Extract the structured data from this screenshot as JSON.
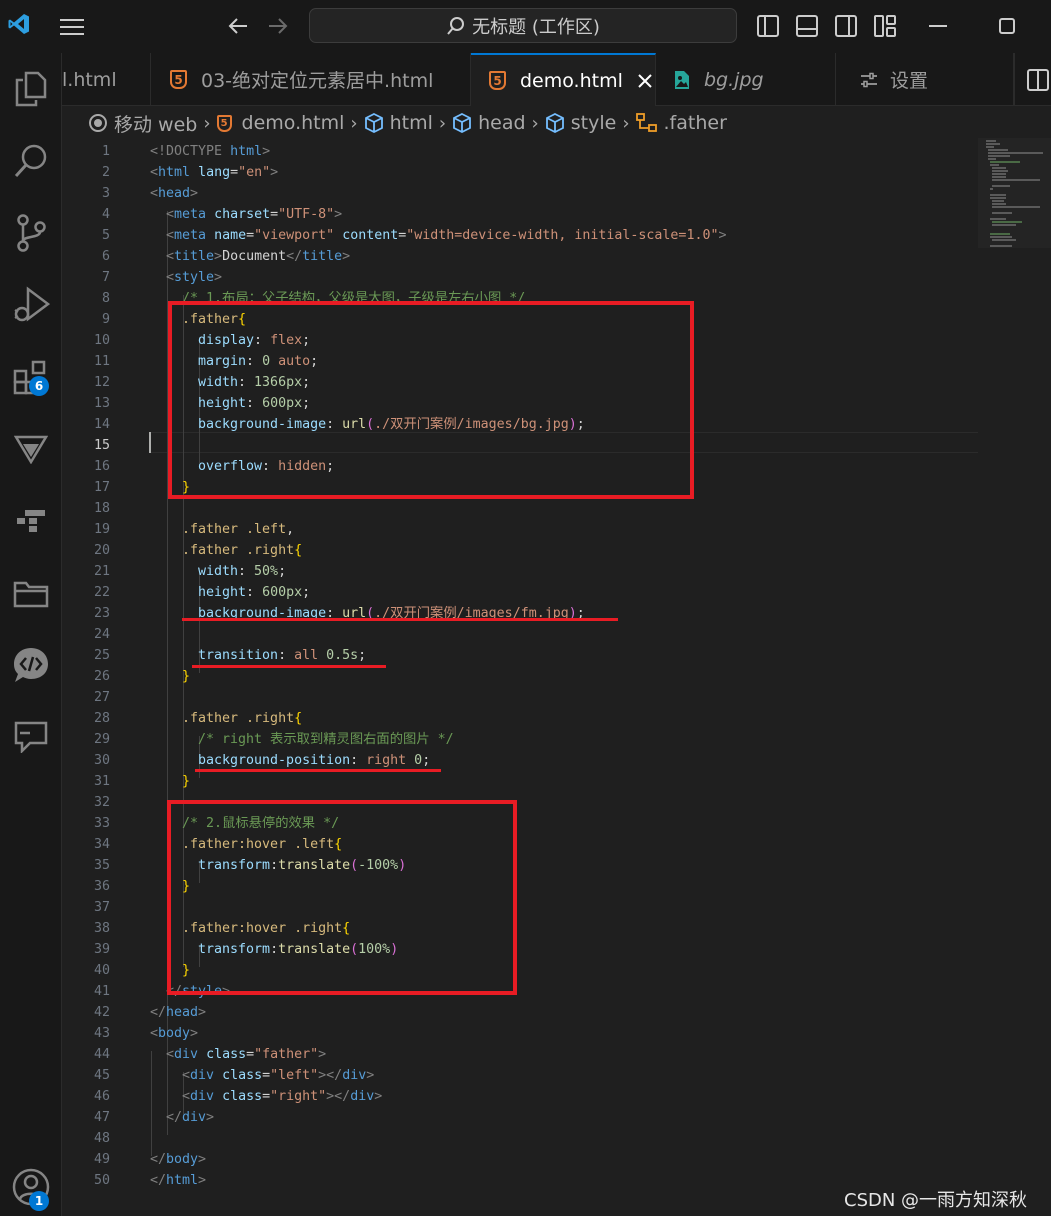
{
  "titlebar": {
    "search_text": "无标题 (工作区)"
  },
  "activity": {
    "extensions_badge": "6",
    "accounts_badge": "1"
  },
  "tabs": [
    {
      "label": "l.html"
    },
    {
      "label": "03-绝对定位元素居中.html"
    },
    {
      "label": "demo.html"
    },
    {
      "label": "bg.jpg"
    },
    {
      "label": "设置"
    }
  ],
  "breadcrumb": [
    "移动 web",
    "demo.html",
    "html",
    "head",
    "style",
    ".father"
  ],
  "line_numbers": [
    "1",
    "2",
    "3",
    "4",
    "5",
    "6",
    "7",
    "8",
    "9",
    "10",
    "11",
    "12",
    "13",
    "14",
    "15",
    "16",
    "17",
    "18",
    "19",
    "20",
    "21",
    "22",
    "23",
    "24",
    "25",
    "26",
    "27",
    "28",
    "29",
    "30",
    "31",
    "32",
    "33",
    "34",
    "35",
    "36",
    "37",
    "38",
    "39",
    "40",
    "41",
    "42",
    "43",
    "44",
    "45",
    "46",
    "47",
    "48",
    "49",
    "50"
  ],
  "code": {
    "l1": [
      "<!DOCTYPE ",
      "html",
      ">"
    ],
    "l2": [
      "<",
      "html",
      " ",
      "lang",
      "=",
      "\"en\"",
      ">"
    ],
    "l3": [
      "<",
      "head",
      ">"
    ],
    "l4": [
      "<",
      "meta",
      " ",
      "charset",
      "=",
      "\"UTF-8\"",
      ">"
    ],
    "l5": [
      "<",
      "meta",
      " ",
      "name",
      "=",
      "\"viewport\"",
      " ",
      "content",
      "=",
      "\"width=device-width, initial-scale=1.0\"",
      ">"
    ],
    "l6": [
      "<",
      "title",
      ">",
      "Document",
      "</",
      "title",
      ">"
    ],
    "l7": [
      "<",
      "style",
      ">"
    ],
    "l8": "/* 1.布局：父子结构，父级是大图，子级是左右小图 */",
    "l9": [
      ".father",
      "{"
    ],
    "l10": [
      "display",
      ": ",
      "flex",
      ";"
    ],
    "l11": [
      "margin",
      ": ",
      "0",
      " ",
      "auto",
      ";"
    ],
    "l12": [
      "width",
      ": ",
      "1366px",
      ";"
    ],
    "l13": [
      "height",
      ": ",
      "600px",
      ";"
    ],
    "l14": [
      "background-image",
      ": ",
      "url",
      "(",
      "./双开门案例/images/bg.jpg",
      ")",
      ";"
    ],
    "l16": [
      "overflow",
      ": ",
      "hidden",
      ";"
    ],
    "l17": "}",
    "l19": [
      ".father .left",
      ","
    ],
    "l20": [
      ".father .right",
      "{"
    ],
    "l21": [
      "width",
      ": ",
      "50%",
      ";"
    ],
    "l22": [
      "height",
      ": ",
      "600px",
      ";"
    ],
    "l23": [
      "background-image",
      ": ",
      "url",
      "(",
      "./双开门案例/images/fm.jpg",
      ")",
      ";"
    ],
    "l25": [
      "transition",
      ": ",
      "all",
      " ",
      "0.5s",
      ";"
    ],
    "l26": "}",
    "l28": [
      ".father .right",
      "{"
    ],
    "l29": "/* right 表示取到精灵图右面的图片 */",
    "l30": [
      "background-position",
      ": ",
      "right",
      " ",
      "0",
      ";"
    ],
    "l31": "}",
    "l33": "/* 2.鼠标悬停的效果 */",
    "l34": [
      ".father:hover .left",
      "{"
    ],
    "l35": [
      "transform",
      ":",
      "translate",
      "(",
      "-100%",
      ")"
    ],
    "l36": "}",
    "l38": [
      ".father:hover .right",
      "{"
    ],
    "l39": [
      "transform",
      ":",
      "translate",
      "(",
      "100%",
      ")"
    ],
    "l40": "}",
    "l41": [
      "</",
      "style",
      ">"
    ],
    "l42": [
      "</",
      "head",
      ">"
    ],
    "l43": [
      "<",
      "body",
      ">"
    ],
    "l44": [
      "<",
      "div",
      " ",
      "class",
      "=",
      "\"father\"",
      ">"
    ],
    "l45": [
      "<",
      "div",
      " ",
      "class",
      "=",
      "\"left\"",
      "></",
      "div",
      ">"
    ],
    "l46": [
      "<",
      "div",
      " ",
      "class",
      "=",
      "\"right\"",
      "></",
      "div",
      ">"
    ],
    "l47": [
      "</",
      "div",
      ">"
    ],
    "l49": [
      "</",
      "body",
      ">"
    ],
    "l50": [
      "</",
      "html",
      ">"
    ]
  },
  "watermark": "CSDN @一雨方知深秋",
  "colors": {
    "annotation": "#e81c24",
    "accent": "#0078d4",
    "html_icon": "#e37933"
  }
}
